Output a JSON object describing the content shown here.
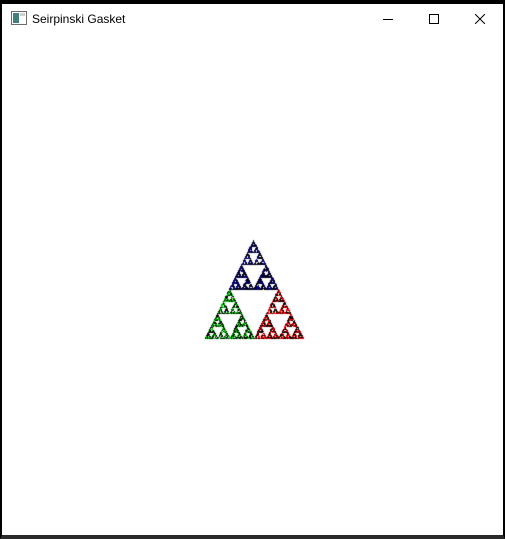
{
  "window": {
    "title": "Seirpinski Gasket",
    "app_icon": "window-app-icon",
    "controls": {
      "minimize_icon": "minimize-icon",
      "maximize_icon": "maximize-icon",
      "close_icon": "close-icon"
    }
  },
  "canvas": {
    "background": "#ffffff",
    "colors": [
      "#000080",
      "#ff0000",
      "#00cc00",
      "#000000"
    ]
  }
}
